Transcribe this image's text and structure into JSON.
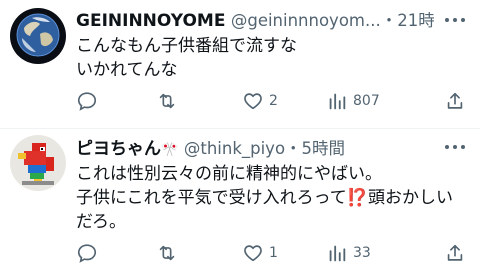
{
  "tweets": [
    {
      "display_name": "GEININNOYOME",
      "handle": "@geininnnoyom...",
      "time": "・21時間",
      "text": "こんなもん子供番組で流すな\nいかれてんな",
      "avatar_icon": "earth-avatar-icon",
      "counts": {
        "reply": "",
        "retweet": "",
        "like": "2",
        "views": "807"
      }
    },
    {
      "display_name": "ピヨちゃん",
      "name_badge": "🎌",
      "handle": "@think_piyo",
      "time": "・5時間",
      "text": "これは性別云々の前に精神的にやばい。\n子供にこれを平気で受け入れろって⁉️頭おかしい\nだろ。",
      "avatar_icon": "lego-parrot-avatar-icon",
      "counts": {
        "reply": "",
        "retweet": "",
        "like": "1",
        "views": "33"
      }
    }
  ],
  "colors": {
    "text": "#0f1419",
    "secondary": "#536471",
    "divider": "#eff3f4"
  }
}
